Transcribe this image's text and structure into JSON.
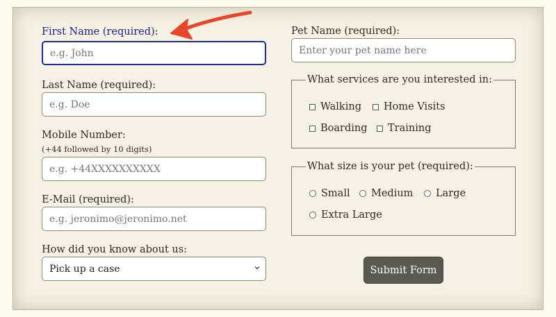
{
  "form": {
    "first_name": {
      "label": "First Name (required):",
      "placeholder": "e.g. John"
    },
    "last_name": {
      "label": "Last Name (required):",
      "placeholder": "e.g. Doe"
    },
    "mobile": {
      "label": "Mobile Number:",
      "hint": "(+44 followed by 10 digits)",
      "placeholder": "e.g. +44XXXXXXXXXX"
    },
    "email": {
      "label": "E-Mail (required):",
      "placeholder": "e.g. jeronimo@jeronimo.net"
    },
    "referral": {
      "label": "How did you know about us:",
      "selected": "Pick up a case"
    },
    "pet_name": {
      "label": "Pet Name (required):",
      "placeholder": "Enter your pet name here"
    },
    "services": {
      "legend": "What services are you interested in:",
      "options": [
        "Walking",
        "Home Visits",
        "Boarding",
        "Training"
      ]
    },
    "pet_size": {
      "legend": "What size is your pet (required):",
      "options": [
        "Small",
        "Medium",
        "Large",
        "Extra Large"
      ]
    },
    "submit_label": "Submit Form"
  },
  "colors": {
    "background": "#fbf8ec",
    "focus_border": "#1a2c9a",
    "focus_label": "#1c1a8c",
    "submit_bg": "#5b5a50",
    "annotation_arrow": "#e8452a"
  },
  "icons": {
    "select_chevron": "chevron-down-icon",
    "annotation": "red-arrow-icon"
  }
}
